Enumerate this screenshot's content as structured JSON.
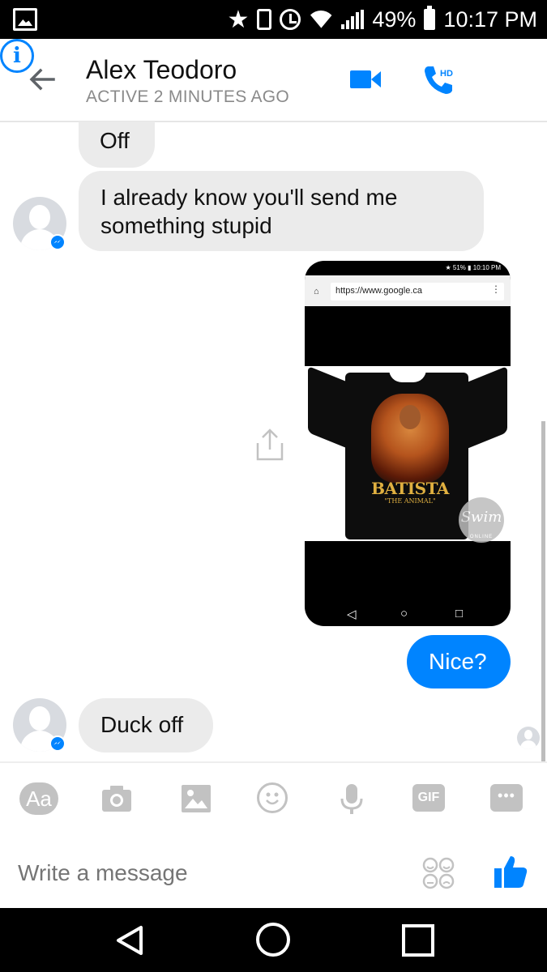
{
  "status_bar": {
    "battery": "49%",
    "time": "10:17 PM"
  },
  "header": {
    "contact_name": "Alex Teodoro",
    "contact_status": "ACTIVE 2 MINUTES AGO",
    "call_badge": "HD",
    "info_glyph": "i"
  },
  "thread": {
    "messages": [
      {
        "from": "contact",
        "text": "Off"
      },
      {
        "from": "contact",
        "text": "I already know you'll send me something stupid"
      },
      {
        "from": "me",
        "type": "image"
      },
      {
        "from": "me",
        "text": "Nice?"
      },
      {
        "from": "contact",
        "text": "Duck off"
      }
    ]
  },
  "attachment": {
    "status_text": "51%",
    "status_time": "10:10 PM",
    "url": "https://www.google.ca",
    "menu_glyph": "⋮",
    "shirt_title": "BATISTA",
    "shirt_subtitle": "\"THE ANIMAL\"",
    "logo_text": "Swim",
    "logo_sub": "ONLINE"
  },
  "composer": {
    "aa_label": "Aa",
    "gif_label": "GIF",
    "more_label": "•••",
    "placeholder": "Write a message"
  },
  "colors": {
    "accent": "#0084ff",
    "bubble_in": "#ebebeb",
    "icon_gray": "#c2c2c2"
  }
}
